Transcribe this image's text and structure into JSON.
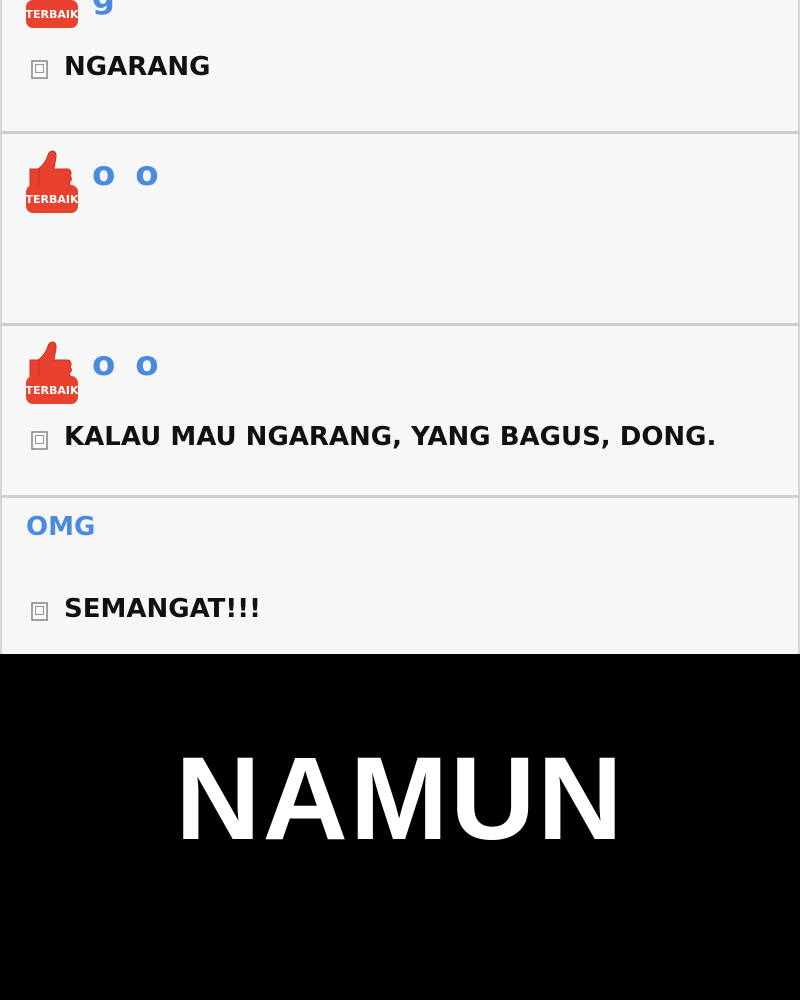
{
  "comments": [
    {
      "badge": "TERBAIK",
      "username": "g",
      "text": "NGARANG"
    },
    {
      "badge": "TERBAIK",
      "username": "o o",
      "text": ""
    },
    {
      "badge": "TERBAIK",
      "username": "o o",
      "text": "KALAU MAU NGARANG, YANG BAGUS, DONG."
    },
    {
      "username": "OMG",
      "text": "SEMANGAT!!!"
    }
  ],
  "caption": "NAMUN",
  "colors": {
    "username": "#4a8be0",
    "badge": "#e8412e",
    "panel_background": "#f7f7f7",
    "caption_background": "#000000",
    "caption_text": "#ffffff"
  },
  "icons": {
    "badge_icon": "thumbs-up-icon",
    "reply_icon": "document-icon"
  }
}
